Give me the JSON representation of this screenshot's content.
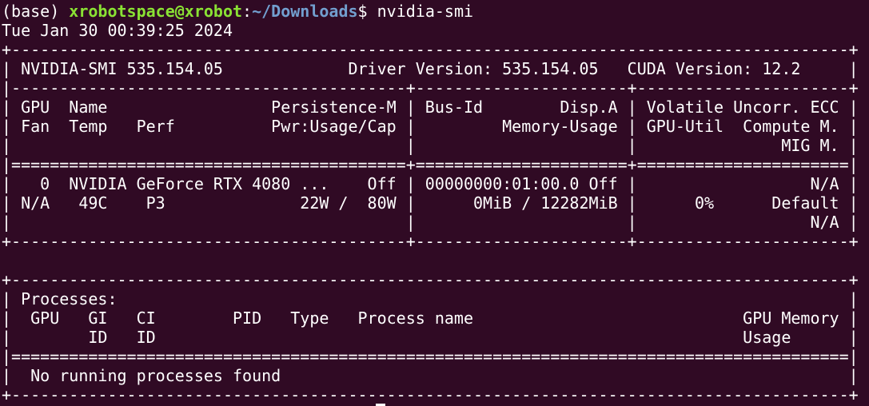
{
  "prompt": {
    "env": "(base) ",
    "user_host": "xrobotspace@xrobot",
    "colon": ":",
    "cwd": "~/Downloads",
    "symbol": "$ ",
    "command": "nvidia-smi"
  },
  "output_lines": [
    "Tue Jan 30 00:39:25 2024",
    "+---------------------------------------------------------------------------------------+",
    "| NVIDIA-SMI 535.154.05             Driver Version: 535.154.05   CUDA Version: 12.2     |",
    "|-----------------------------------------+----------------------+----------------------+",
    "| GPU  Name                 Persistence-M | Bus-Id        Disp.A | Volatile Uncorr. ECC |",
    "| Fan  Temp   Perf          Pwr:Usage/Cap |         Memory-Usage | GPU-Util  Compute M. |",
    "|                                         |                      |               MIG M. |",
    "|=========================================+======================+======================|",
    "|   0  NVIDIA GeForce RTX 4080 ...    Off | 00000000:01:00.0 Off |                  N/A |",
    "| N/A   49C    P3              22W /  80W |      0MiB / 12282MiB |      0%      Default |",
    "|                                         |                      |                  N/A |",
    "+-----------------------------------------+----------------------+----------------------+",
    "",
    "+---------------------------------------------------------------------------------------+",
    "| Processes:                                                                            |",
    "|  GPU   GI   CI        PID   Type   Process name                            GPU Memory |",
    "|        ID   ID                                                             Usage      |",
    "|=======================================================================================|",
    "|  No running processes found                                                           |",
    "+---------------------------------------------------------------------------------------+"
  ]
}
